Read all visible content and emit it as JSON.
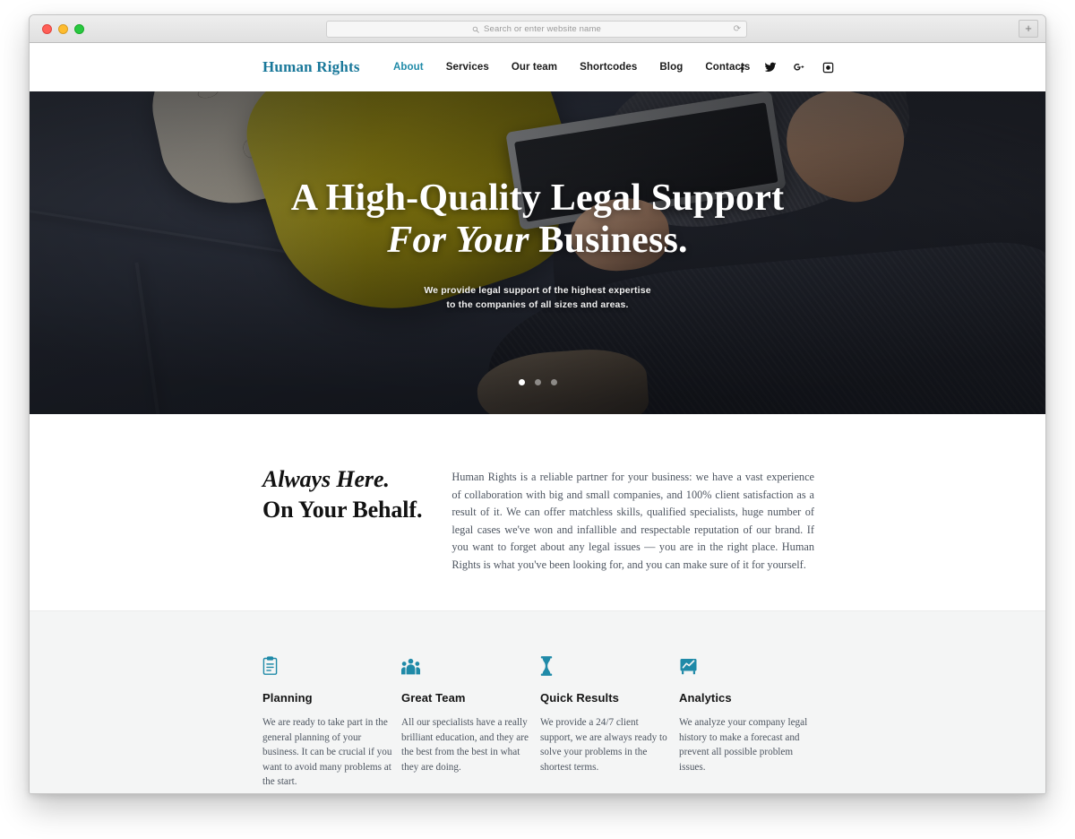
{
  "browser": {
    "traffic_lights": [
      "close",
      "minimize",
      "zoom"
    ],
    "address_placeholder": "Search or enter website name",
    "reload_icon": "reload-icon",
    "search_icon": "search-icon",
    "new_tab_label": "+"
  },
  "site": {
    "logo": "Human Rights",
    "nav": [
      {
        "label": "About",
        "active": true
      },
      {
        "label": "Services",
        "active": false
      },
      {
        "label": "Our team",
        "active": false
      },
      {
        "label": "Shortcodes",
        "active": false
      },
      {
        "label": "Blog",
        "active": false
      },
      {
        "label": "Contacts",
        "active": false
      }
    ],
    "social": [
      {
        "name": "facebook-icon",
        "glyph": "f"
      },
      {
        "name": "twitter-icon",
        "glyph": "t"
      },
      {
        "name": "google-plus-icon",
        "glyph": "g+"
      },
      {
        "name": "instagram-icon",
        "glyph": "ig"
      }
    ]
  },
  "hero": {
    "title_line1": "A High-Quality Legal Support",
    "title_line2_italic": "For Your ",
    "title_line2_rest": "Business.",
    "subtitle_line1": "We provide legal support of the highest expertise",
    "subtitle_line2": "to the companies of all sizes and areas.",
    "slides": 3,
    "active_slide": 1
  },
  "about": {
    "heading_italic": "Always Here.",
    "heading_bold": "On Your Behalf.",
    "body": "Human Rights is a reliable partner for your business: we have a vast experience of collaboration with big and small companies, and 100% client satisfaction as a result of it. We can offer matchless skills, qualified specialists, huge number of legal cases we've won and infallible and respectable reputation of our brand. If you want to forget about any legal issues — you are in the right place. Human Rights is what you've been looking for, and you can make sure of it for yourself."
  },
  "features": [
    {
      "icon": "clipboard-icon",
      "title": "Planning",
      "text": "We are ready to take part in the general planning of your business. It can be crucial if you want to avoid many problems at the start."
    },
    {
      "icon": "team-group-icon",
      "title": "Great Team",
      "text": "All our specialists have a really brilliant education, and they are the best from the best in what they are doing."
    },
    {
      "icon": "hourglass-icon",
      "title": "Quick Results",
      "text": "We provide a 24/7 client support, we are always ready to solve your problems in the shortest terms."
    },
    {
      "icon": "analytics-chart-icon",
      "title": "Analytics",
      "text": "We analyze your company legal history to make a forecast and prevent all possible problem issues."
    }
  ],
  "colors": {
    "accent": "#1f8aa8",
    "logo": "#19789a",
    "heading": "#121212",
    "body_text": "#4d5560",
    "features_bg": "#f4f5f5"
  }
}
